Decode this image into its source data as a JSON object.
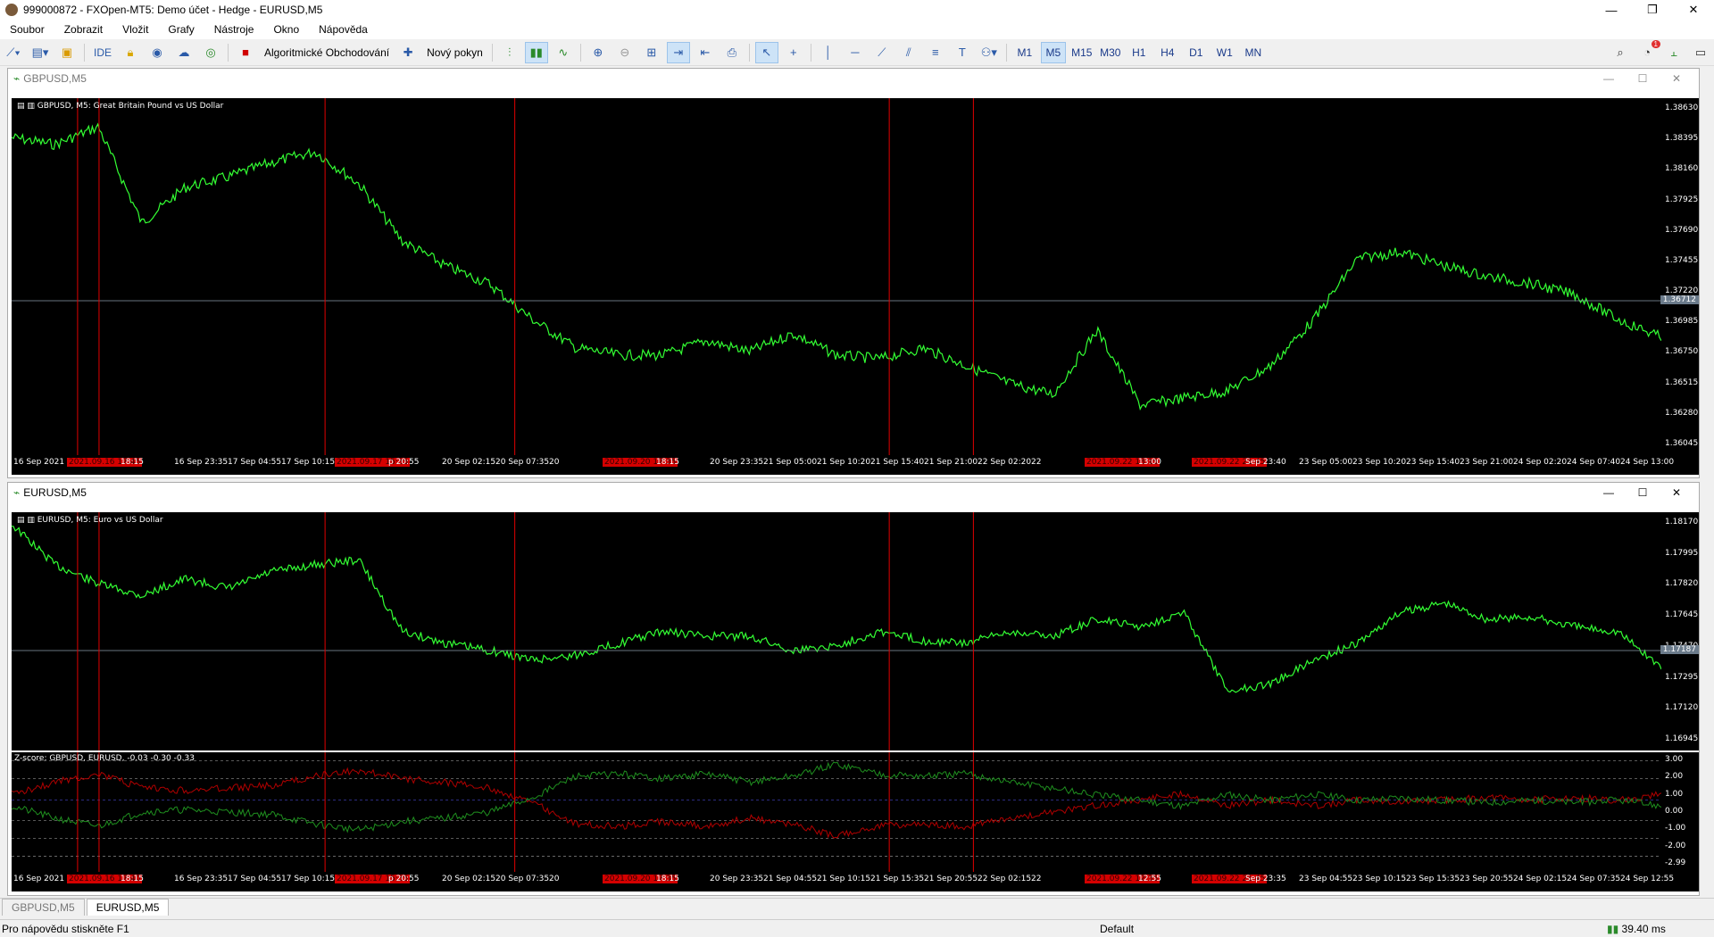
{
  "window": {
    "title": "999000872 - FXOpen-MT5: Demo účet - Hedge - EURUSD,M5",
    "controls": [
      "—",
      "❐",
      "✕"
    ]
  },
  "menu": [
    "Soubor",
    "Zobrazit",
    "Vložit",
    "Grafy",
    "Nástroje",
    "Okno",
    "Nápověda"
  ],
  "toolbar": {
    "ide_label": "IDE",
    "algo_label": "Algoritmické Obchodování",
    "new_order_label": "Nový pokyn",
    "timeframes": [
      "M1",
      "M5",
      "M15",
      "M30",
      "H1",
      "H4",
      "D1",
      "W1",
      "MN"
    ],
    "active_timeframe": "M5",
    "notification_count": "1"
  },
  "chart1": {
    "window_title": "GBPUSD,M5",
    "symbol_label": "GBPUSD, M5:  Great Britain Pound vs US Dollar",
    "price_ticks": [
      "1.38630",
      "1.38395",
      "1.38160",
      "1.37925",
      "1.37690",
      "1.37455",
      "1.37220",
      "1.36985",
      "1.36750",
      "1.36515",
      "1.36280",
      "1.36045"
    ],
    "current_price": "1.36712",
    "time_ticks": [
      "16 Sep 2021",
      "2021.09.16 17:45",
      "18:15",
      "16 Sep 23:35",
      "17 Sep 04:55",
      "17 Sep 10:15",
      "2021.09.17 15:35",
      "p 20:55",
      "20 Sep 02:15",
      "20 Sep 07:35",
      "20",
      "2021.09.20 17:35",
      "18:15",
      "20 Sep 23:35",
      "21 Sep 05:00",
      "21 Sep 10:20",
      "21 Sep 15:40",
      "21 Sep 21:00",
      "22 Sep 02:20",
      "22",
      "2021.09.22 13:15",
      "13:00",
      "2021.09.22 21:45",
      "Sep 23:40",
      "23 Sep 05:00",
      "23 Sep 10:20",
      "23 Sep 15:40",
      "23 Sep 21:00",
      "24 Sep 02:20",
      "24 Sep 07:40",
      "24 Sep 13:00"
    ]
  },
  "chart2": {
    "window_title": "EURUSD,M5",
    "symbol_label": "EURUSD, M5:  Euro vs US Dollar",
    "price_ticks": [
      "1.18170",
      "1.17995",
      "1.17820",
      "1.17645",
      "1.17470",
      "1.17295",
      "1.17120",
      "1.16945"
    ],
    "current_price": "1.17187",
    "indicator_label": "Z-score: GBPUSD, EURUSD,  -0.03 -0.30 -0.33",
    "indicator_ticks": [
      "3.00",
      "2.00",
      "1.00",
      "0.00",
      "-1.00",
      "-2.00",
      "-2.99"
    ],
    "indicator_top": "3.10",
    "time_ticks": [
      "16 Sep 2021",
      "2021.09.16 17:40",
      "18:15",
      "16 Sep 23:35",
      "17 Sep 04:55",
      "17 Sep 10:15",
      "2021.09.17 15:35",
      "p 20:55",
      "20 Sep 02:15",
      "20 Sep 07:35",
      "20",
      "2021.09.20 17:35",
      "18:15",
      "20 Sep 23:35",
      "21 Sep 04:55",
      "21 Sep 10:15",
      "21 Sep 15:35",
      "21 Sep 20:55",
      "22 Sep 02:15",
      "22",
      "2021.09.22 12:35",
      "12:55",
      "2021.09.22 21:45",
      "Sep 23:35",
      "23 Sep 04:55",
      "23 Sep 10:15",
      "23 Sep 15:35",
      "23 Sep 20:55",
      "24 Sep 02:15",
      "24 Sep 07:35",
      "24 Sep 12:55"
    ]
  },
  "tabs": [
    "GBPUSD,M5",
    "EURUSD,M5"
  ],
  "active_tab": "EURUSD,M5",
  "status": {
    "help": "Pro nápovědu stiskněte F1",
    "profile": "Default",
    "ping": "39.40 ms"
  },
  "colors": {
    "price_line": "#33ff33",
    "zscore_gbp": "#b00000",
    "zscore_eur": "#1f8f1f",
    "marker_line": "#e00000",
    "background": "#000000"
  }
}
